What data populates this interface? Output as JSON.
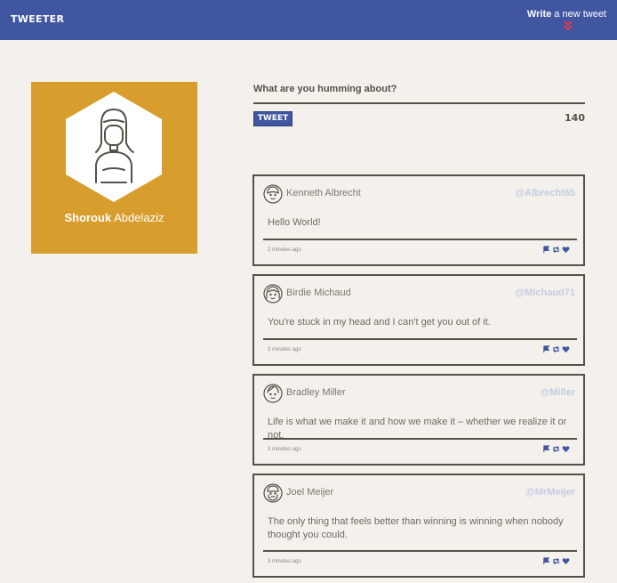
{
  "nav": {
    "brand": "TWEETER",
    "compose_bold": "Write",
    "compose_rest": " a new tweet",
    "compose_arrow_icon": "double-chevron-down-icon"
  },
  "profile": {
    "avatar_icon": "woman-avatar-icon",
    "first_name": "Shorouk",
    "last_name": " Abdelaziz",
    "color": "#d89e2d"
  },
  "composer": {
    "prompt": "What are you humming about?",
    "button_label": "TWEET",
    "counter": "140"
  },
  "tweets": [
    {
      "name": "Kenneth Albrecht",
      "handle": "@Albrecht65",
      "content": "Hello World!",
      "time": "2 minutes ago",
      "avatar_icon": "man-avatar-icon"
    },
    {
      "name": "Birdie Michaud",
      "handle": "@Michaud71",
      "content": "You're stuck in my head and I can't get you out of it.",
      "time": "3 minutes ago",
      "avatar_icon": "woman-avatar-icon"
    },
    {
      "name": "Bradley Miller",
      "handle": "@Miller",
      "content": "Life is what we make it and how we make it – whether we realize it or not.",
      "time": "3 minutes ago",
      "avatar_icon": "man-avatar-icon"
    },
    {
      "name": "Joel Meijer",
      "handle": "@MrMeijer",
      "content": "The only thing that feels better than winning is winning when nobody thought you could.",
      "time": "3 minutes ago",
      "avatar_icon": "bearded-man-avatar-icon"
    }
  ],
  "colors": {
    "nav": "#4056a1",
    "background": "#f4f1ec",
    "accent": "#d89e2d",
    "handle": "#c5cbe3",
    "arrow": "#e63946"
  }
}
